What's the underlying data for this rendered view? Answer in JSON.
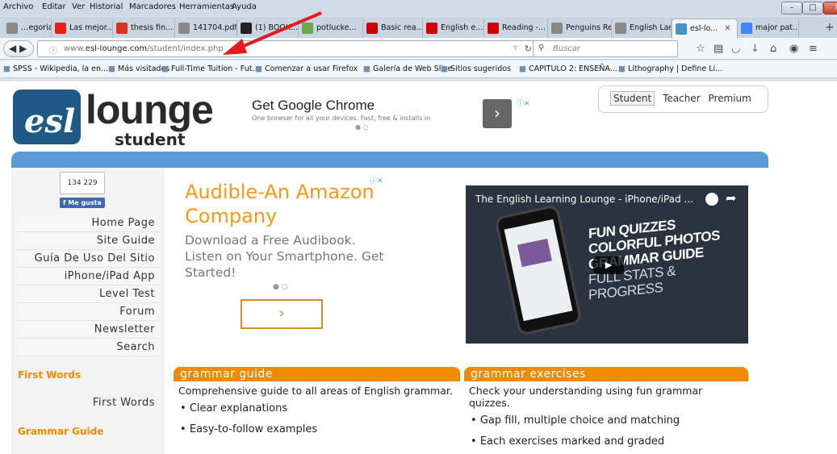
{
  "menubar": {
    "items": [
      "Archivo",
      "Editar",
      "Ver",
      "Historial",
      "Marcadores",
      "Herramientas",
      "Ayuda"
    ]
  },
  "tabs": [
    {
      "label": "…egoria...",
      "icon": "chevron-left-icon",
      "color": "#888"
    },
    {
      "label": "Las mejor...",
      "icon": "youtube-icon",
      "color": "#e62117"
    },
    {
      "label": "thesis fin...",
      "icon": "gmail-icon",
      "color": "#d93025"
    },
    {
      "label": "141704.pdf",
      "icon": "pdf-icon",
      "color": "#888"
    },
    {
      "label": "(1) BOOK...",
      "icon": "academia-icon",
      "color": "#222"
    },
    {
      "label": "potlucke...",
      "icon": "potluck-icon",
      "color": "#6aa84f"
    },
    {
      "label": "Basic rea...",
      "icon": "jstor-icon",
      "color": "#c00"
    },
    {
      "label": "English e...",
      "icon": "jstor-icon",
      "color": "#c00"
    },
    {
      "label": "Reading -...",
      "icon": "jstor-icon",
      "color": "#c00"
    },
    {
      "label": "Penguins Rea...",
      "icon": "page-icon",
      "color": "#888"
    },
    {
      "label": "English Lang...",
      "icon": "page-icon",
      "color": "#888"
    },
    {
      "label": "esl-lo...",
      "icon": "esl-icon",
      "color": "#4a90c8",
      "active": true
    },
    {
      "label": "major pat...",
      "icon": "google-icon",
      "color": "#4285f4"
    }
  ],
  "navbar": {
    "url_prefix": "www.",
    "url_domain": "esl-lounge.com",
    "url_path": "/student/index.php",
    "search_placeholder": "Buscar"
  },
  "bookmarks": [
    {
      "label": "SPSS - Wikipedia, la en...",
      "icon": "wikipedia-icon"
    },
    {
      "label": "Más visitados",
      "icon": "folder-icon"
    },
    {
      "label": "Full-Time Tuition - Fut...",
      "icon": "tuition-icon"
    },
    {
      "label": "Comenzar a usar Firefox",
      "icon": "firefox-icon"
    },
    {
      "label": "Galería de Web Slice",
      "icon": "web-slice-icon"
    },
    {
      "label": "Sitios sugeridos",
      "icon": "suggested-sites-icon"
    },
    {
      "label": "CAPITULO 2: ENSEÑA...",
      "icon": "page-icon"
    },
    {
      "label": "Lithography | Define Li...",
      "icon": "lithography-icon"
    }
  ],
  "site": {
    "logo_bubble": "esl",
    "logo_main": "lounge",
    "logo_sub": "student",
    "ad_chrome_title": "Get Google Chrome",
    "ad_chrome_sub": "One browser for all your devices. Fast, free & installs in",
    "user_tabs": [
      "Student",
      "Teacher",
      "Premium"
    ],
    "like_count": "134 229",
    "like_label": "Me gusta",
    "nav": [
      "Home Page",
      "Site Guide",
      "Guía De Uso Del Sitio",
      "iPhone/iPad App",
      "Level Test",
      "Forum",
      "Newsletter",
      "Search"
    ],
    "first_words_head": "First Words",
    "first_words_item": "First Words",
    "grammar_guide_head": "Grammar Guide",
    "ad_title": "Audible-An Amazon Company",
    "ad_body": "Download a Free Audibook. Listen on Your Smartphone. Get Started!",
    "video_title": "The English Learning Lounge - iPhone/iPad ...",
    "video_lines": [
      "FUN QUIZZES",
      "COLORFUL PHOTOS",
      "GRAMMAR GUIDE",
      "FULL STATS & PROGRESS"
    ],
    "grammar_guide": {
      "head": "grammar guide",
      "desc": "Comprehensive guide to all areas of English grammar.",
      "items": [
        "Clear explanations",
        "Easy-to-follow examples"
      ]
    },
    "grammar_exercises": {
      "head": "grammar exercises",
      "desc": "Check your understanding using fun grammar quizzes.",
      "items": [
        "Gap fill, multiple choice and matching",
        "Each exercises marked and graded"
      ]
    }
  }
}
